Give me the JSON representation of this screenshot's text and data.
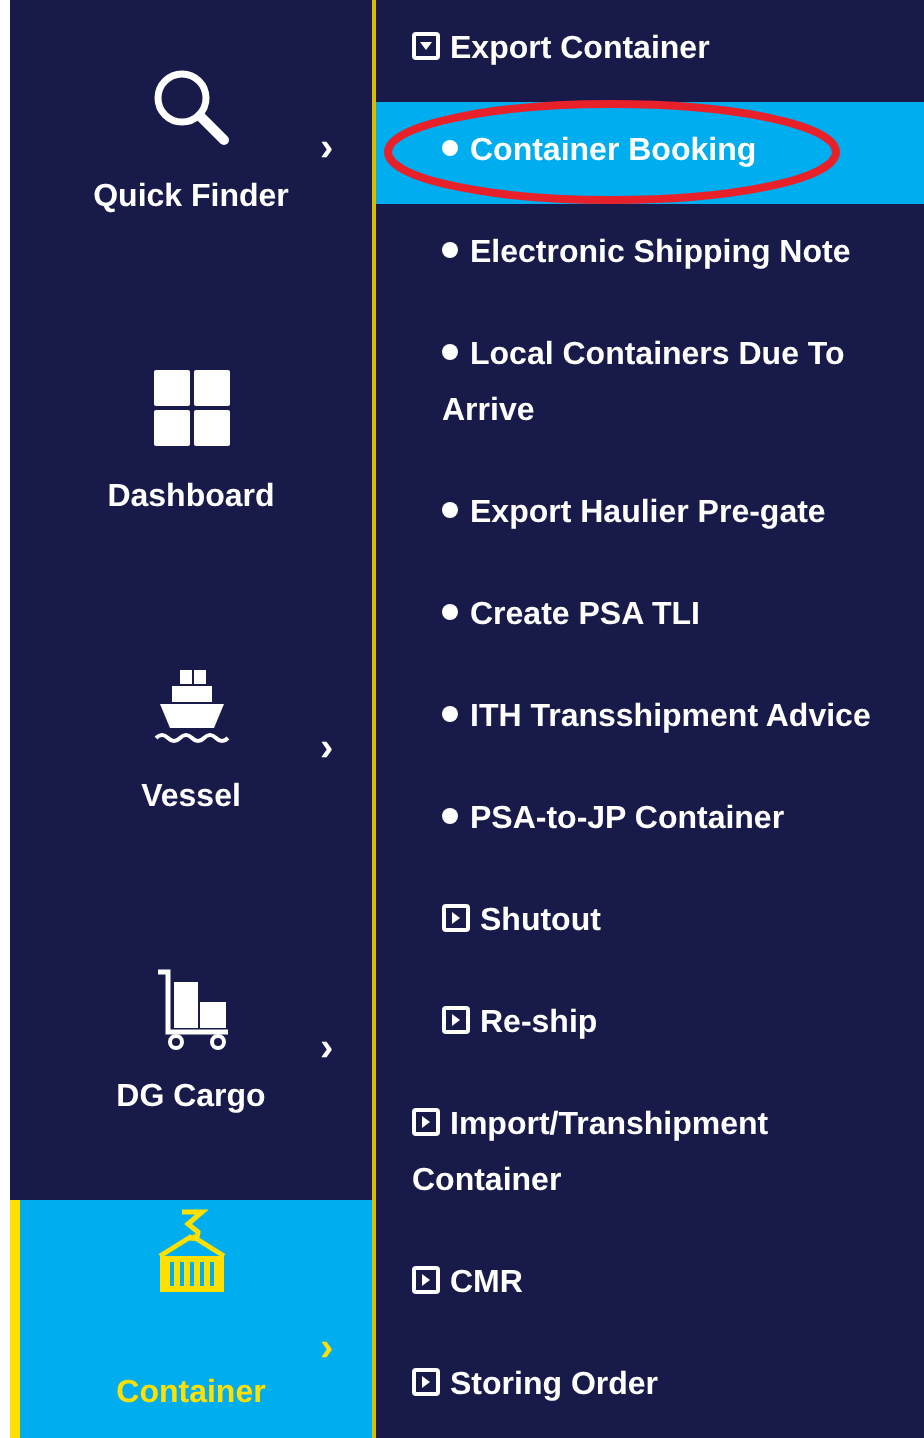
{
  "sidebar": {
    "items": [
      {
        "label": "Quick Finder",
        "chevron": "›",
        "selected": false
      },
      {
        "label": "Dashboard",
        "selected": false
      },
      {
        "label": "Vessel",
        "chevron": "›",
        "selected": false
      },
      {
        "label": "DG Cargo",
        "chevron": "›",
        "selected": false
      },
      {
        "label": "Container",
        "chevron": "›",
        "selected": true
      }
    ]
  },
  "menu": {
    "items": [
      {
        "kind": "group",
        "label": "Export Container",
        "expanded": true,
        "selected": false,
        "children": [
          {
            "kind": "page",
            "label": "Container Booking",
            "selected": true,
            "circled": true
          },
          {
            "kind": "page",
            "label": "Electronic Shipping Note",
            "selected": false
          },
          {
            "kind": "page",
            "label": "Local Containers Due To Arrive",
            "selected": false
          },
          {
            "kind": "page",
            "label": "Export Haulier Pre-gate",
            "selected": false
          },
          {
            "kind": "page",
            "label": "Create PSA TLI",
            "selected": false
          },
          {
            "kind": "page",
            "label": "ITH Transshipment Advice",
            "selected": false
          },
          {
            "kind": "page",
            "label": "PSA-to-JP Container",
            "selected": false
          },
          {
            "kind": "group",
            "label": "Shutout",
            "expanded": false,
            "selected": false
          },
          {
            "kind": "group",
            "label": "Re-ship",
            "expanded": false,
            "selected": false
          }
        ]
      },
      {
        "kind": "group",
        "label": "Import/Transhipment Container",
        "expanded": false,
        "selected": false
      },
      {
        "kind": "group",
        "label": "CMR",
        "expanded": false,
        "selected": false
      },
      {
        "kind": "group",
        "label": "Storing Order",
        "expanded": false,
        "selected": false
      }
    ]
  }
}
